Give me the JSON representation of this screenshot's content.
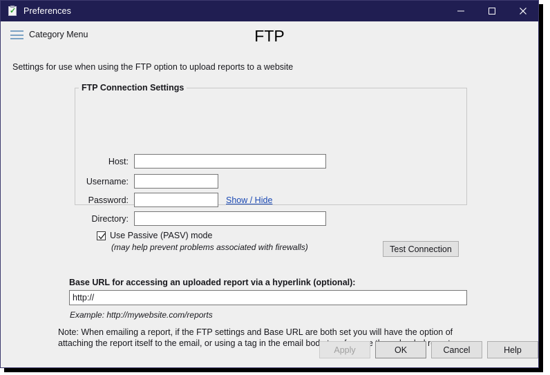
{
  "window": {
    "title": "Preferences",
    "icon": "clipboard-check-icon",
    "titlebar_color": "#201e52",
    "minimize_label": "Minimize",
    "maximize_label": "Maximize",
    "close_label": "Close"
  },
  "header": {
    "category_menu_label": "Category Menu",
    "page_title": "FTP"
  },
  "intro": "Settings for use when using the FTP option to upload reports to a website",
  "group": {
    "legend": "FTP Connection Settings",
    "fields": [
      {
        "label": "Host:",
        "value": "",
        "placeholder": ""
      },
      {
        "label": "Username:",
        "value": "",
        "placeholder": ""
      },
      {
        "label": "Password:",
        "value": "",
        "placeholder": ""
      },
      {
        "label": "Directory:",
        "value": "",
        "placeholder": ""
      }
    ],
    "show_hide_link": "Show / Hide",
    "passive": {
      "label": "Use Passive (PASV) mode",
      "checked": true,
      "hint": "(may help prevent problems associated with firewalls)"
    },
    "test_connection_label": "Test Connection"
  },
  "base_url": {
    "label": "Base URL for accessing an uploaded report via a hyperlink (optional):",
    "value": "http://",
    "placeholder": "",
    "example": "Example: http://mywebsite.com/reports"
  },
  "note": "Note: When emailing a report, if the FTP settings and Base URL are both set you will have the option of attaching the report itself to the email, or using a tag in the email body to reference the uploaded report.",
  "footer": {
    "apply_label": "Apply",
    "apply_enabled": false,
    "ok_label": "OK",
    "cancel_label": "Cancel",
    "help_label": "Help"
  },
  "colors": {
    "titlebar": "#201e52",
    "dialog_bg": "#efefef",
    "link": "#1a49b4",
    "accent_burger": "#7ba2c4",
    "check_green": "#2aa02a"
  }
}
